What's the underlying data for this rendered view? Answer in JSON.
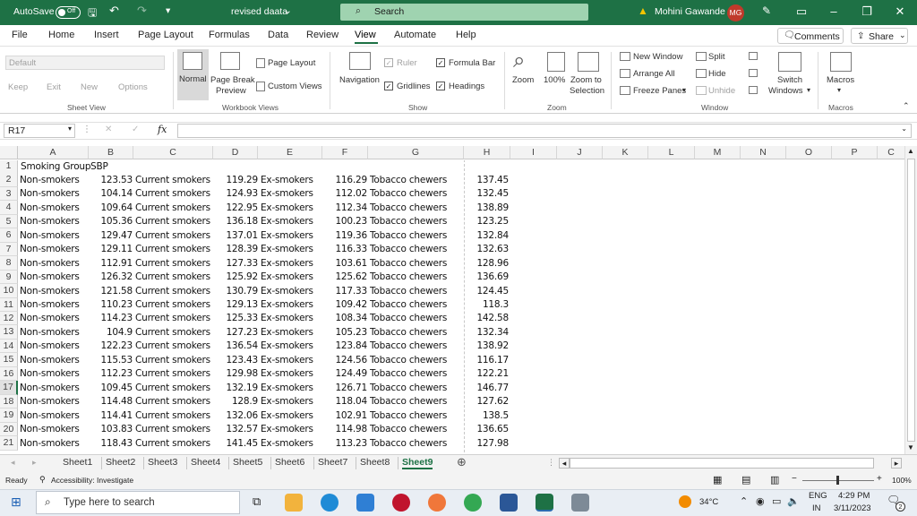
{
  "title_bar": {
    "autosave": "AutoSave",
    "autosave_state": "Off",
    "doc_title": "revised daata",
    "search_label": "Search",
    "user": "Mohini Gawande",
    "user_initials": "MG",
    "warning_icon": "warning-icon"
  },
  "menu": {
    "items": [
      "File",
      "Home",
      "Insert",
      "Page Layout",
      "Formulas",
      "Data",
      "Review",
      "View",
      "Automate",
      "Help"
    ],
    "active": "View",
    "comments": "Comments",
    "share": "Share"
  },
  "ribbon": {
    "sheet_view": {
      "default_placeholder": "Default",
      "keep": "Keep",
      "exit": "Exit",
      "new": "New",
      "options": "Options",
      "group": "Sheet View"
    },
    "workbook_views": {
      "normal": "Normal",
      "page_break_1": "Page Break",
      "page_break_2": "Preview",
      "page_layout": "Page Layout",
      "custom_views": "Custom Views",
      "group": "Workbook Views"
    },
    "show": {
      "navigation": "Navigation",
      "ruler": "Ruler",
      "formula_bar": "Formula Bar",
      "gridlines": "Gridlines",
      "headings": "Headings",
      "group": "Show"
    },
    "zoom": {
      "zoom": "Zoom",
      "hundred": "100%",
      "zoom_sel_1": "Zoom to",
      "zoom_sel_2": "Selection",
      "group": "Zoom"
    },
    "window": {
      "new_window": "New Window",
      "arrange_all": "Arrange All",
      "freeze_panes": "Freeze Panes",
      "split": "Split",
      "hide": "Hide",
      "unhide": "Unhide",
      "switch_1": "Switch",
      "switch_2": "Windows",
      "group": "Window"
    },
    "macros": {
      "macros": "Macros",
      "group": "Macros"
    }
  },
  "formula_bar": {
    "name_box": "R17",
    "fx": "fx",
    "value": ""
  },
  "columns": [
    "A",
    "B",
    "C",
    "D",
    "E",
    "F",
    "G",
    "H",
    "I",
    "J",
    "K",
    "L",
    "M",
    "N",
    "O",
    "P",
    "C"
  ],
  "row_numbers": [
    "1",
    "2",
    "3",
    "4",
    "5",
    "6",
    "7",
    "8",
    "9",
    "10",
    "11",
    "12",
    "13",
    "14",
    "15",
    "16",
    "17",
    "18",
    "19",
    "20",
    "21"
  ],
  "header_row": {
    "a": "Smoking Group",
    "b": "SBP"
  },
  "rows": [
    [
      "Non-smokers",
      "123.53",
      "Current smokers",
      "119.29",
      "Ex-smokers",
      "116.29",
      "Tobacco chewers",
      "137.45"
    ],
    [
      "Non-smokers",
      "104.14",
      "Current smokers",
      "124.93",
      "Ex-smokers",
      "112.02",
      "Tobacco chewers",
      "132.45"
    ],
    [
      "Non-smokers",
      "109.64",
      "Current smokers",
      "122.95",
      "Ex-smokers",
      "112.34",
      "Tobacco chewers",
      "138.89"
    ],
    [
      "Non-smokers",
      "105.36",
      "Current smokers",
      "136.18",
      "Ex-smokers",
      "100.23",
      "Tobacco chewers",
      "123.25"
    ],
    [
      "Non-smokers",
      "129.47",
      "Current smokers",
      "137.01",
      "Ex-smokers",
      "119.36",
      "Tobacco chewers",
      "132.84"
    ],
    [
      "Non-smokers",
      "129.11",
      "Current smokers",
      "128.39",
      "Ex-smokers",
      "116.33",
      "Tobacco chewers",
      "132.63"
    ],
    [
      "Non-smokers",
      "112.91",
      "Current smokers",
      "127.33",
      "Ex-smokers",
      "103.61",
      "Tobacco chewers",
      "128.96"
    ],
    [
      "Non-smokers",
      "126.32",
      "Current smokers",
      "125.92",
      "Ex-smokers",
      "125.62",
      "Tobacco chewers",
      "136.69"
    ],
    [
      "Non-smokers",
      "121.58",
      "Current smokers",
      "130.79",
      "Ex-smokers",
      "117.33",
      "Tobacco chewers",
      "124.45"
    ],
    [
      "Non-smokers",
      "110.23",
      "Current smokers",
      "129.13",
      "Ex-smokers",
      "109.42",
      "Tobacco chewers",
      "118.3"
    ],
    [
      "Non-smokers",
      "114.23",
      "Current smokers",
      "125.33",
      "Ex-smokers",
      "108.34",
      "Tobacco chewers",
      "142.58"
    ],
    [
      "Non-smokers",
      "104.9",
      "Current smokers",
      "127.23",
      "Ex-smokers",
      "105.23",
      "Tobacco chewers",
      "132.34"
    ],
    [
      "Non-smokers",
      "122.23",
      "Current smokers",
      "136.54",
      "Ex-smokers",
      "123.84",
      "Tobacco chewers",
      "138.92"
    ],
    [
      "Non-smokers",
      "115.53",
      "Current smokers",
      "123.43",
      "Ex-smokers",
      "124.56",
      "Tobacco chewers",
      "116.17"
    ],
    [
      "Non-smokers",
      "112.23",
      "Current smokers",
      "129.98",
      "Ex-smokers",
      "124.49",
      "Tobacco chewers",
      "122.21"
    ],
    [
      "Non-smokers",
      "109.45",
      "Current smokers",
      "132.19",
      "Ex-smokers",
      "126.71",
      "Tobacco chewers",
      "146.77"
    ],
    [
      "Non-smokers",
      "114.48",
      "Current smokers",
      "128.9",
      "Ex-smokers",
      "118.04",
      "Tobacco chewers",
      "127.62"
    ],
    [
      "Non-smokers",
      "114.41",
      "Current smokers",
      "132.06",
      "Ex-smokers",
      "102.91",
      "Tobacco chewers",
      "138.5"
    ],
    [
      "Non-smokers",
      "103.83",
      "Current smokers",
      "132.57",
      "Ex-smokers",
      "114.98",
      "Tobacco chewers",
      "136.65"
    ],
    [
      "Non-smokers",
      "118.43",
      "Current smokers",
      "141.45",
      "Ex-smokers",
      "113.23",
      "Tobacco chewers",
      "127.98"
    ]
  ],
  "sheets": [
    "Sheet1",
    "Sheet2",
    "Sheet3",
    "Sheet4",
    "Sheet5",
    "Sheet6",
    "Sheet7",
    "Sheet8",
    "Sheet9"
  ],
  "active_sheet": "Sheet9",
  "status": {
    "ready": "Ready",
    "accessibility": "Accessibility: Investigate",
    "zoom": "100%"
  },
  "taskbar": {
    "search_placeholder": "Type here to search",
    "temp": "34°C",
    "lang_1": "ENG",
    "lang_2": "IN",
    "time": "4:29 PM",
    "date": "3/11/2023",
    "notif_count": "2"
  },
  "colors": {
    "excel_green": "#1e7145",
    "search_green": "#9fd3b0",
    "ribbon_bg": "#ffffff"
  }
}
